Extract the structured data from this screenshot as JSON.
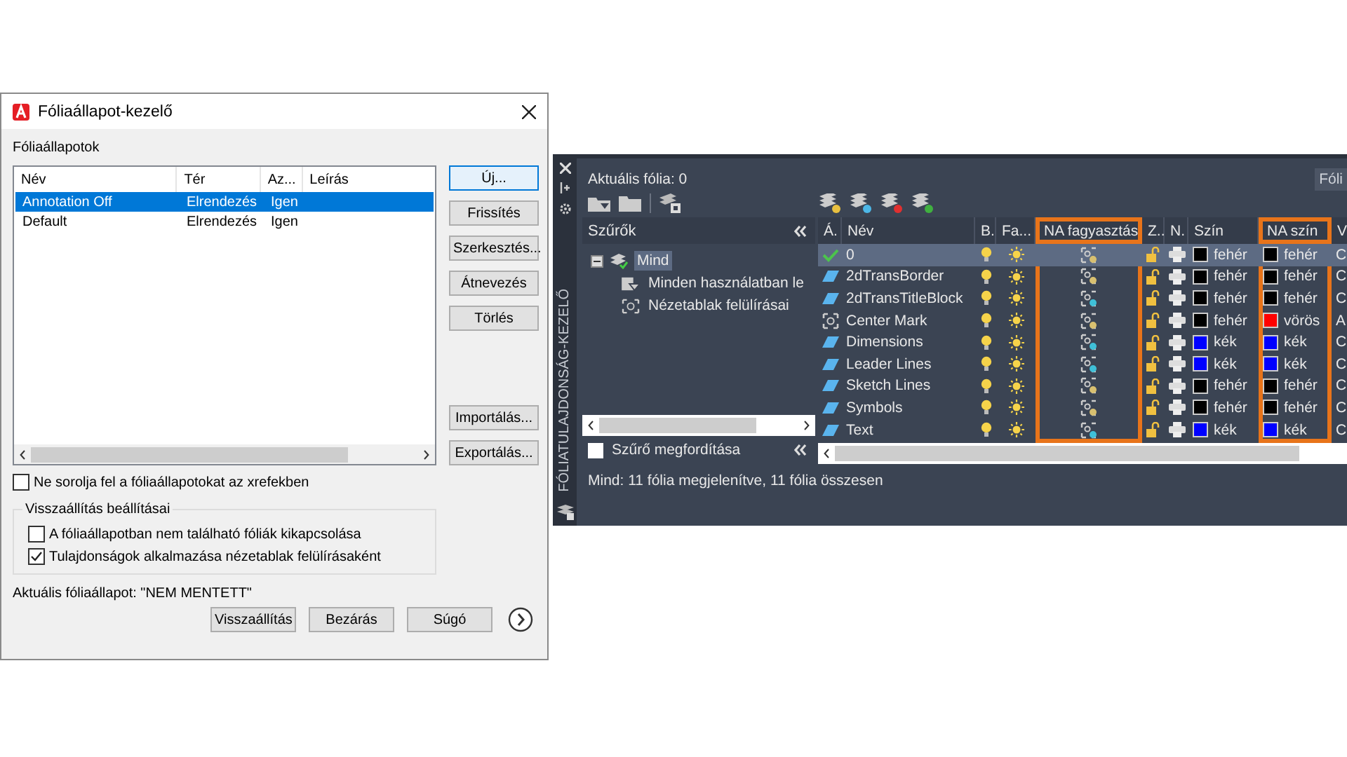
{
  "dialog": {
    "title": "Fóliaállapot-kezelő",
    "list_label": "Fóliaállapotok",
    "columns": [
      "Név",
      "Tér",
      "Az...",
      "Leírás"
    ],
    "rows": [
      {
        "name": "Annotation Off",
        "space": "Elrendezés",
        "column_3": "Igen",
        "selected": true
      },
      {
        "name": "Default",
        "space": "Elrendezés",
        "column_3": "Igen",
        "selected": false
      }
    ],
    "side_buttons": [
      {
        "label": "Új...",
        "focused": true
      },
      {
        "label": "Frissítés",
        "focused": false
      },
      {
        "label": "Szerkesztés...",
        "focused": false
      },
      {
        "label": "Átnevezés",
        "focused": false
      },
      {
        "label": "Törlés",
        "focused": false
      }
    ],
    "lower_buttons": [
      "Importálás...",
      "Exportálás..."
    ],
    "xref_checkbox": {
      "label": "Ne sorolja fel a fóliaállapotokat az xrefekben",
      "checked": false
    },
    "restore_group": {
      "title": "Visszaállítás beállításai",
      "options": [
        {
          "label": "A fóliaállapotban nem található fóliák kikapcsolása",
          "checked": false
        },
        {
          "label": "Tulajdonságok alkalmazása nézetablak felülírásaként",
          "checked": true
        }
      ]
    },
    "current_state": "Aktuális fóliaállapot: \"NEM MENTETT\"",
    "footer_buttons": [
      "Visszaállítás",
      "Bezárás",
      "Súgó"
    ]
  },
  "palette": {
    "title": "FÓLIATULAJDONSÁG-KEZELŐ",
    "current_layer": "Aktuális fólia: 0",
    "search_partial": "Fóli",
    "filters": {
      "title": "Szűrők",
      "tree": [
        {
          "label": "Mind",
          "selected": true,
          "children": [
            {
              "label": "Minden használatban le",
              "kind": "filter"
            },
            {
              "label": "Nézetablak felülírásai",
              "kind": "viewport"
            }
          ]
        }
      ],
      "invert": {
        "label": "Szűrő megfordítása",
        "checked": false
      }
    },
    "layers": {
      "columns": [
        {
          "label": "Á.",
          "highlighted": false
        },
        {
          "label": "Név",
          "highlighted": false
        },
        {
          "label": "B.",
          "highlighted": false
        },
        {
          "label": "Fa...",
          "highlighted": false
        },
        {
          "label": "NA fagyasztás",
          "highlighted": true
        },
        {
          "label": "Z..",
          "highlighted": false
        },
        {
          "label": "N.",
          "highlighted": false
        },
        {
          "label": "Szín",
          "highlighted": false
        },
        {
          "label": "NA szín",
          "highlighted": true
        },
        {
          "label": "V",
          "highlighted": false
        }
      ],
      "rows": [
        {
          "kind": "current",
          "name": "0",
          "on": true,
          "frozen": false,
          "vp_override": false,
          "locked": false,
          "plot": true,
          "color": "#000000",
          "color_name": "fehér",
          "na": {
            "color": "#000000",
            "label": "fehér"
          },
          "column_10": "C",
          "selected": true
        },
        {
          "kind": "layer",
          "name": "2dTransBorder",
          "on": true,
          "frozen": false,
          "vp_override": false,
          "locked": false,
          "plot": true,
          "color": "#000000",
          "color_name": "fehér",
          "na": {
            "color": "#000000",
            "label": "fehér"
          },
          "column_10": "C",
          "selected": false
        },
        {
          "kind": "layer",
          "name": "2dTransTitleBlock",
          "on": true,
          "frozen": false,
          "vp_override": true,
          "locked": false,
          "plot": true,
          "color": "#000000",
          "color_name": "fehér",
          "na": {
            "color": "#000000",
            "label": "fehér"
          },
          "column_10": "C",
          "selected": false
        },
        {
          "kind": "viewport",
          "name": "Center Mark",
          "on": true,
          "frozen": false,
          "vp_override": false,
          "locked": false,
          "plot": true,
          "color": "#000000",
          "color_name": "fehér",
          "na": {
            "color": "#ff0000",
            "label": "vörös"
          },
          "column_10": "A",
          "selected": false
        },
        {
          "kind": "layer",
          "name": "Dimensions",
          "on": true,
          "frozen": false,
          "vp_override": true,
          "locked": false,
          "plot": true,
          "color": "#0000ff",
          "color_name": "kék",
          "na": {
            "color": "#0000ff",
            "label": "kék"
          },
          "column_10": "C",
          "selected": false
        },
        {
          "kind": "layer",
          "name": "Leader Lines",
          "on": true,
          "frozen": false,
          "vp_override": true,
          "locked": false,
          "plot": true,
          "color": "#0000ff",
          "color_name": "kék",
          "na": {
            "color": "#0000ff",
            "label": "kék"
          },
          "column_10": "C",
          "selected": false
        },
        {
          "kind": "layer",
          "name": "Sketch Lines",
          "on": true,
          "frozen": false,
          "vp_override": false,
          "locked": false,
          "plot": true,
          "color": "#000000",
          "color_name": "fehér",
          "na": {
            "color": "#000000",
            "label": "fehér"
          },
          "column_10": "C",
          "selected": false
        },
        {
          "kind": "layer",
          "name": "Symbols",
          "on": true,
          "frozen": false,
          "vp_override": false,
          "locked": false,
          "plot": true,
          "color": "#000000",
          "color_name": "fehér",
          "na": {
            "color": "#000000",
            "label": "fehér"
          },
          "column_10": "C",
          "selected": false
        },
        {
          "kind": "layer",
          "name": "Text",
          "on": true,
          "frozen": false,
          "vp_override": true,
          "locked": false,
          "plot": true,
          "color": "#0000ff",
          "color_name": "kék",
          "na": {
            "color": "#0000ff",
            "label": "kék"
          },
          "column_10": "C",
          "selected": false
        }
      ]
    },
    "status": "Mind: 11 fólia megjelenítve, 11 fólia összesen"
  }
}
